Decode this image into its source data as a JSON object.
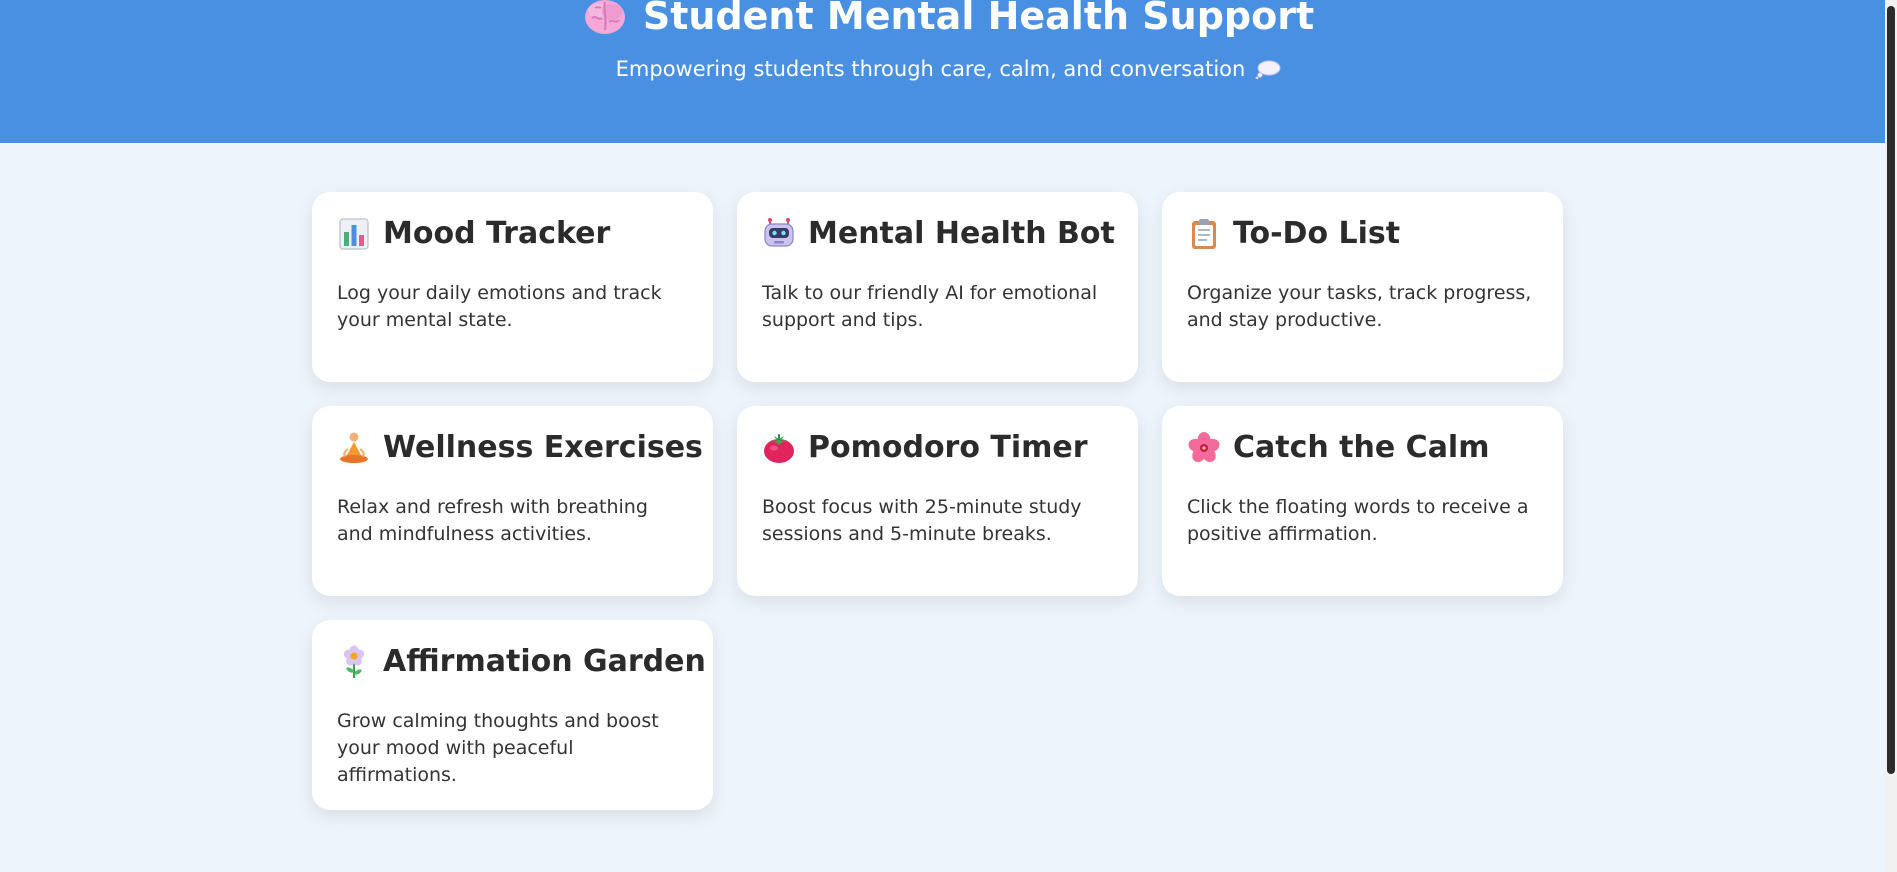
{
  "header": {
    "title": "Student Mental Health Support",
    "title_icon": "brain-icon",
    "subtitle": "Empowering students through care, calm, and conversation",
    "subtitle_icon": "speech-bubble-icon",
    "background_color": "#4a90e2"
  },
  "cards": [
    {
      "icon": "bar-chart-icon",
      "title": "Mood Tracker",
      "description": "Log your daily emotions and track your mental state."
    },
    {
      "icon": "robot-icon",
      "title": "Mental Health Bot",
      "description": "Talk to our friendly AI for emotional support and tips."
    },
    {
      "icon": "clipboard-icon",
      "title": "To-Do List",
      "description": "Organize your tasks, track progress, and stay productive."
    },
    {
      "icon": "meditation-icon",
      "title": "Wellness Exercises",
      "description": "Relax and refresh with breathing and mindfulness activities."
    },
    {
      "icon": "tomato-icon",
      "title": "Pomodoro Timer",
      "description": "Boost focus with 25-minute study sessions and 5-minute breaks."
    },
    {
      "icon": "hibiscus-icon",
      "title": "Catch the Calm",
      "description": "Click the floating words to receive a positive affirmation."
    },
    {
      "icon": "flower-icon",
      "title": "Affirmation Garden",
      "description": "Grow calming thoughts and boost your mood with peaceful affirmations."
    }
  ],
  "colors": {
    "page_background": "#eef4fb",
    "card_background": "#ffffff",
    "text": "#2b2b2b"
  }
}
